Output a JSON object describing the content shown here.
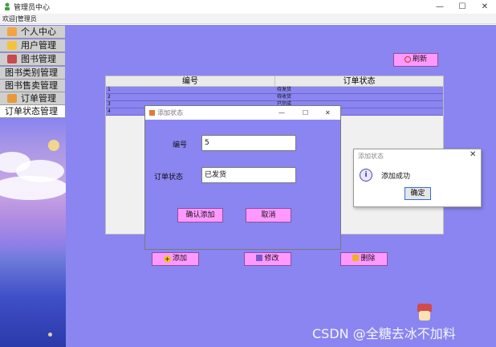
{
  "window": {
    "title": "管理员中心",
    "minimize": "—",
    "maximize": "☐",
    "close": "✕"
  },
  "menubar": {
    "welcome": "欢迎",
    "separator": "|",
    "user": "管理员"
  },
  "sidebar": {
    "items": [
      {
        "label": "个人中心",
        "icon": "person-icon"
      },
      {
        "label": "用户管理",
        "icon": "user-icon"
      },
      {
        "label": "图书管理",
        "icon": "books-icon"
      },
      {
        "label": "图书类别管理"
      },
      {
        "label": "图书售卖管理"
      },
      {
        "label": "订单管理",
        "icon": "order-icon"
      },
      {
        "label": "订单状态管理"
      }
    ]
  },
  "toolbar": {
    "refresh": "刷新",
    "add": "添加",
    "edit": "修改",
    "delete": "删除"
  },
  "table": {
    "headers": [
      "编号",
      "订单状态"
    ],
    "rows": [
      {
        "id": "1",
        "status": "待发货"
      },
      {
        "id": "2",
        "status": "待收货"
      },
      {
        "id": "3",
        "status": "已完成"
      },
      {
        "id": "4",
        "status": ""
      }
    ]
  },
  "add_dialog": {
    "title": "添加状态",
    "id_label": "编号",
    "id_value": "5",
    "status_label": "订单状态",
    "status_value": "已发货",
    "confirm": "确认添加",
    "cancel": "取消",
    "minimize": "—",
    "maximize": "☐",
    "close": "✕"
  },
  "message_box": {
    "title": "添加状态",
    "text": "添加成功",
    "ok": "确定",
    "close": "✕",
    "icon": "info-icon"
  },
  "watermark": "CSDN @全糖去冰不加料",
  "colors": {
    "background": "#8a85f0",
    "button": "#ff99ff",
    "sidebar_item": "#cfcfcf"
  }
}
